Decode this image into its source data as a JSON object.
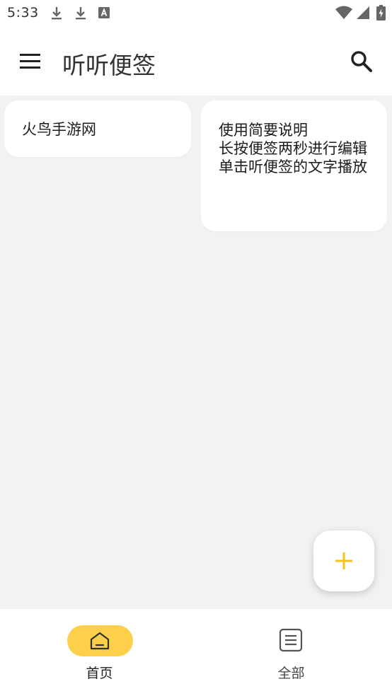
{
  "status_bar": {
    "time": "5:33",
    "icons": [
      "download-icon",
      "download-icon",
      "text-a-icon",
      "wifi-icon",
      "cellular-signal-icon",
      "battery-charging-icon"
    ]
  },
  "app_bar": {
    "title": "听听便签",
    "menu_icon": "menu-icon",
    "search_icon": "search-icon"
  },
  "notes": [
    {
      "text": "火鸟手游网"
    },
    {
      "text": "使用简要说明\n长按便签两秒进行编辑\n单击听便签的文字播放"
    }
  ],
  "fab": {
    "icon": "plus-icon",
    "accent": "#f7c21c"
  },
  "bottom_nav": {
    "items": [
      {
        "label": "首页",
        "icon": "home-icon",
        "selected": true
      },
      {
        "label": "全部",
        "icon": "list-icon",
        "selected": false
      }
    ],
    "selected_color": "#fdd04b"
  }
}
